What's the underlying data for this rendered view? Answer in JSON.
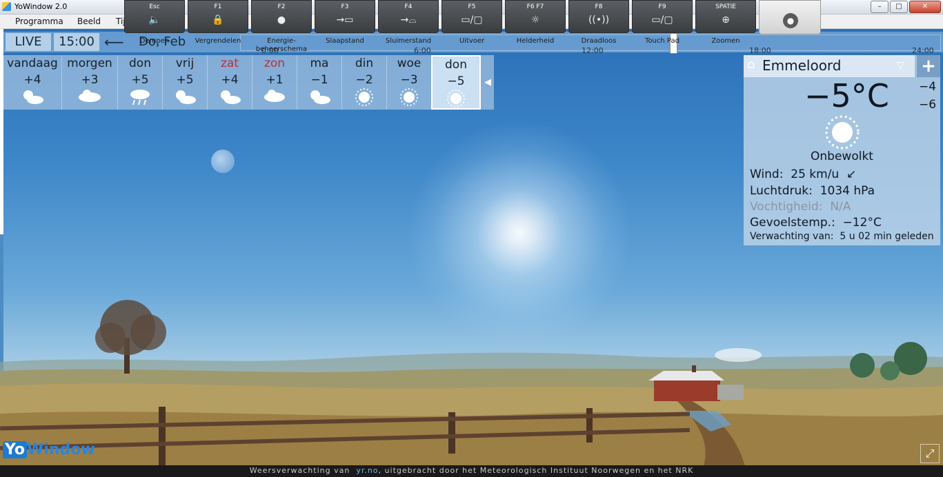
{
  "window": {
    "title": "YoWindow 2.0",
    "minimize": "–",
    "maximize": "□",
    "close": "✕"
  },
  "menu": {
    "items": [
      "Programma",
      "Beeld",
      "Tijd"
    ]
  },
  "fkeys": [
    {
      "key": "Esc",
      "label": "Dempen",
      "icon": "speaker-mute"
    },
    {
      "key": "F1",
      "label": "Vergrendelen",
      "icon": "lock"
    },
    {
      "key": "F2",
      "label": "Energie-beheerschema",
      "icon": "power-plan"
    },
    {
      "key": "F3",
      "label": "Slaapstand",
      "icon": "sleep"
    },
    {
      "key": "F4",
      "label": "Sluimerstand",
      "icon": "hibernate"
    },
    {
      "key": "F5",
      "label": "Uitvoer",
      "icon": "display-output"
    },
    {
      "key": "F6   F7",
      "label": "Helderheid",
      "icon": "brightness"
    },
    {
      "key": "F8",
      "label": "Draadloos",
      "icon": "wireless"
    },
    {
      "key": "F9",
      "label": "Touch Pad",
      "icon": "touchpad"
    },
    {
      "key": "SPATIE",
      "label": "Zoomen",
      "icon": "zoom"
    }
  ],
  "timeline": {
    "live": "LIVE",
    "time": "15:00",
    "date": "Do, Feb",
    "ticks": [
      "0:00",
      "6:00",
      "12:00",
      "18:00",
      "24:00"
    ]
  },
  "forecast": [
    {
      "day": "vandaag",
      "temp": "+4",
      "icon": "partly-cloudy",
      "weekend": false
    },
    {
      "day": "morgen",
      "temp": "+3",
      "icon": "cloudy",
      "weekend": false
    },
    {
      "day": "don",
      "temp": "+5",
      "icon": "rain",
      "weekend": false
    },
    {
      "day": "vrij",
      "temp": "+5",
      "icon": "partly-cloudy",
      "weekend": false
    },
    {
      "day": "zat",
      "temp": "+4",
      "icon": "partly-cloudy",
      "weekend": true
    },
    {
      "day": "zon",
      "temp": "+1",
      "icon": "cloudy",
      "weekend": true
    },
    {
      "day": "ma",
      "temp": "−1",
      "icon": "partly-cloudy",
      "weekend": false
    },
    {
      "day": "din",
      "temp": "−2",
      "icon": "sunny",
      "weekend": false
    },
    {
      "day": "woe",
      "temp": "−3",
      "icon": "sunny",
      "weekend": false
    },
    {
      "day": "don",
      "temp": "−5",
      "icon": "sunny",
      "weekend": false,
      "selected": true
    }
  ],
  "location": {
    "name": "Emmeloord",
    "current_temp": "−5°C",
    "temp_high": "−4",
    "temp_low": "−6",
    "description": "Onbewolkt",
    "wind_label": "Wind:",
    "wind_value": "25 km/u",
    "pressure_label": "Luchtdruk:",
    "pressure_value": "1034 hPa",
    "humidity_label": "Vochtigheid:",
    "humidity_value": "N/A",
    "feels_label": "Gevoelstemp.:",
    "feels_value": "−12°C",
    "forecast_label": "Verwachting van:",
    "forecast_value": "5 u 02 min geleden"
  },
  "footer": {
    "prefix": "Weersverwachting van",
    "link": "yr.no",
    "suffix": ", uitgebracht door het Meteorologisch Instituut Noorwegen en het NRK"
  },
  "logo": {
    "yo": "Yo",
    "window": "Window"
  },
  "colors": {
    "accent": "#1f7ad1",
    "weekend": "#b5313a",
    "sky_top": "#2a6fb8"
  }
}
